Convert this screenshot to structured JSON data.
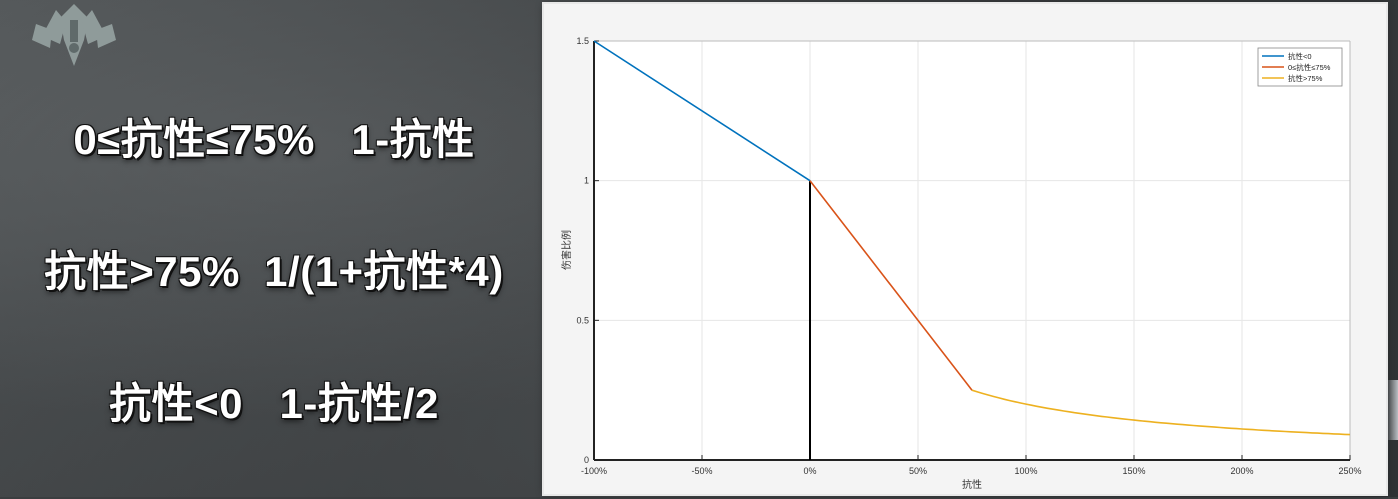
{
  "formulas": {
    "line1": "0≤抗性≤75%   1-抗性",
    "line2": "抗性>75%  1/(1+抗性*4)",
    "line3": "抗性<0   1-抗性/2"
  },
  "chart_data": {
    "type": "line",
    "xlabel": "抗性",
    "ylabel": "伤害比例",
    "xlim": [
      -100,
      250
    ],
    "ylim": [
      0,
      1.5
    ],
    "x_ticks": [
      -100,
      -50,
      0,
      50,
      100,
      150,
      200,
      250
    ],
    "x_tick_labels": [
      "-100%",
      "-50%",
      "0%",
      "50%",
      "100%",
      "150%",
      "200%",
      "250%"
    ],
    "y_ticks": [
      0,
      0.5,
      1,
      1.5
    ],
    "y_tick_labels": [
      "0",
      "0.5",
      "1",
      "1.5"
    ],
    "grid": true,
    "legend_position": "top-right",
    "series": [
      {
        "name": "抗性<0",
        "color": "#0072bd",
        "x": [
          -100,
          0
        ],
        "y": [
          1.5,
          1.0
        ]
      },
      {
        "name": "0≤抗性≤75%",
        "color": "#d95319",
        "x": [
          0,
          75
        ],
        "y": [
          1.0,
          0.25
        ]
      },
      {
        "name": "抗性>75%",
        "color": "#edb120",
        "x": [
          75,
          100,
          125,
          150,
          175,
          200,
          225,
          250
        ],
        "y": [
          0.25,
          0.2,
          0.1667,
          0.1429,
          0.125,
          0.1111,
          0.1,
          0.0909
        ]
      }
    ],
    "vertical_line": {
      "x": 0,
      "y": [
        0,
        1
      ],
      "color": "#000000"
    }
  }
}
